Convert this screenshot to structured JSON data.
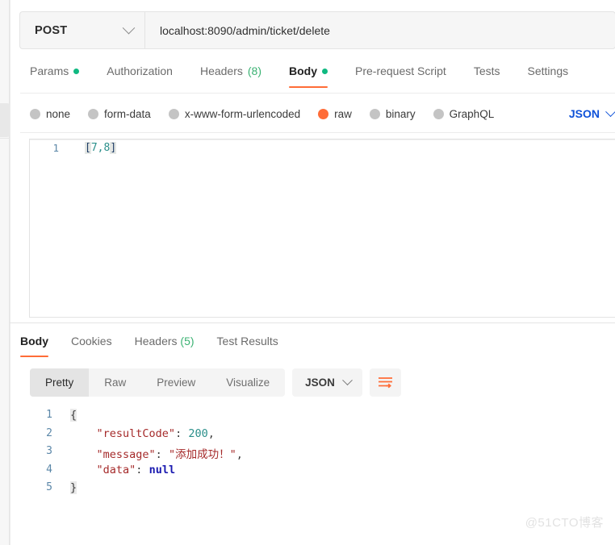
{
  "request": {
    "method": "POST",
    "url": "localhost:8090/admin/ticket/delete",
    "method_chevron_icon": "chevron-down-icon",
    "tabs": [
      {
        "label": "Params",
        "dot": true,
        "active": false
      },
      {
        "label": "Authorization",
        "dot": false,
        "active": false
      },
      {
        "label": "Headers",
        "count": "(8)",
        "dot": false,
        "active": false
      },
      {
        "label": "Body",
        "dot": true,
        "active": true
      },
      {
        "label": "Pre-request Script",
        "dot": false,
        "active": false
      },
      {
        "label": "Tests",
        "dot": false,
        "active": false
      },
      {
        "label": "Settings",
        "dot": false,
        "active": false
      }
    ],
    "body_types": [
      {
        "label": "none",
        "selected": false
      },
      {
        "label": "form-data",
        "selected": false
      },
      {
        "label": "x-www-form-urlencoded",
        "selected": false
      },
      {
        "label": "raw",
        "selected": true
      },
      {
        "label": "binary",
        "selected": false
      },
      {
        "label": "GraphQL",
        "selected": false
      }
    ],
    "raw_format": "JSON",
    "raw_format_chevron_icon": "chevron-down-icon",
    "editor": {
      "line_number": "1",
      "open_bracket": "[",
      "value": "7,8",
      "close_bracket": "]"
    }
  },
  "response": {
    "tabs": [
      {
        "label": "Body",
        "active": true
      },
      {
        "label": "Cookies",
        "active": false
      },
      {
        "label": "Headers",
        "count": "(5)",
        "active": false
      },
      {
        "label": "Test Results",
        "active": false
      }
    ],
    "view_modes": [
      {
        "label": "Pretty",
        "active": true
      },
      {
        "label": "Raw",
        "active": false
      },
      {
        "label": "Preview",
        "active": false
      },
      {
        "label": "Visualize",
        "active": false
      }
    ],
    "format": "JSON",
    "format_chevron_icon": "chevron-down-icon",
    "wrap_icon": "word-wrap-icon",
    "body_lines": [
      {
        "n": "1",
        "brace": "{"
      },
      {
        "n": "2",
        "indent": "    ",
        "key": "\"resultCode\"",
        "colon": ": ",
        "num": "200",
        "tail": ","
      },
      {
        "n": "3",
        "indent": "    ",
        "key": "\"message\"",
        "colon": ": ",
        "str": "\"添加成功！\"",
        "tail": ","
      },
      {
        "n": "4",
        "indent": "    ",
        "key": "\"data\"",
        "colon": ": ",
        "nul": "null"
      },
      {
        "n": "5",
        "brace": "}"
      }
    ]
  },
  "watermark": {
    "text": "@51CTO博客"
  },
  "colors": {
    "accent": "#ff6c37",
    "link": "#0f52d9",
    "dot_green": "#10b981",
    "count_green": "#3bb273",
    "json_key": "#a52a2a",
    "json_num": "#2a8f8a",
    "json_null": "#1a1ab0"
  }
}
